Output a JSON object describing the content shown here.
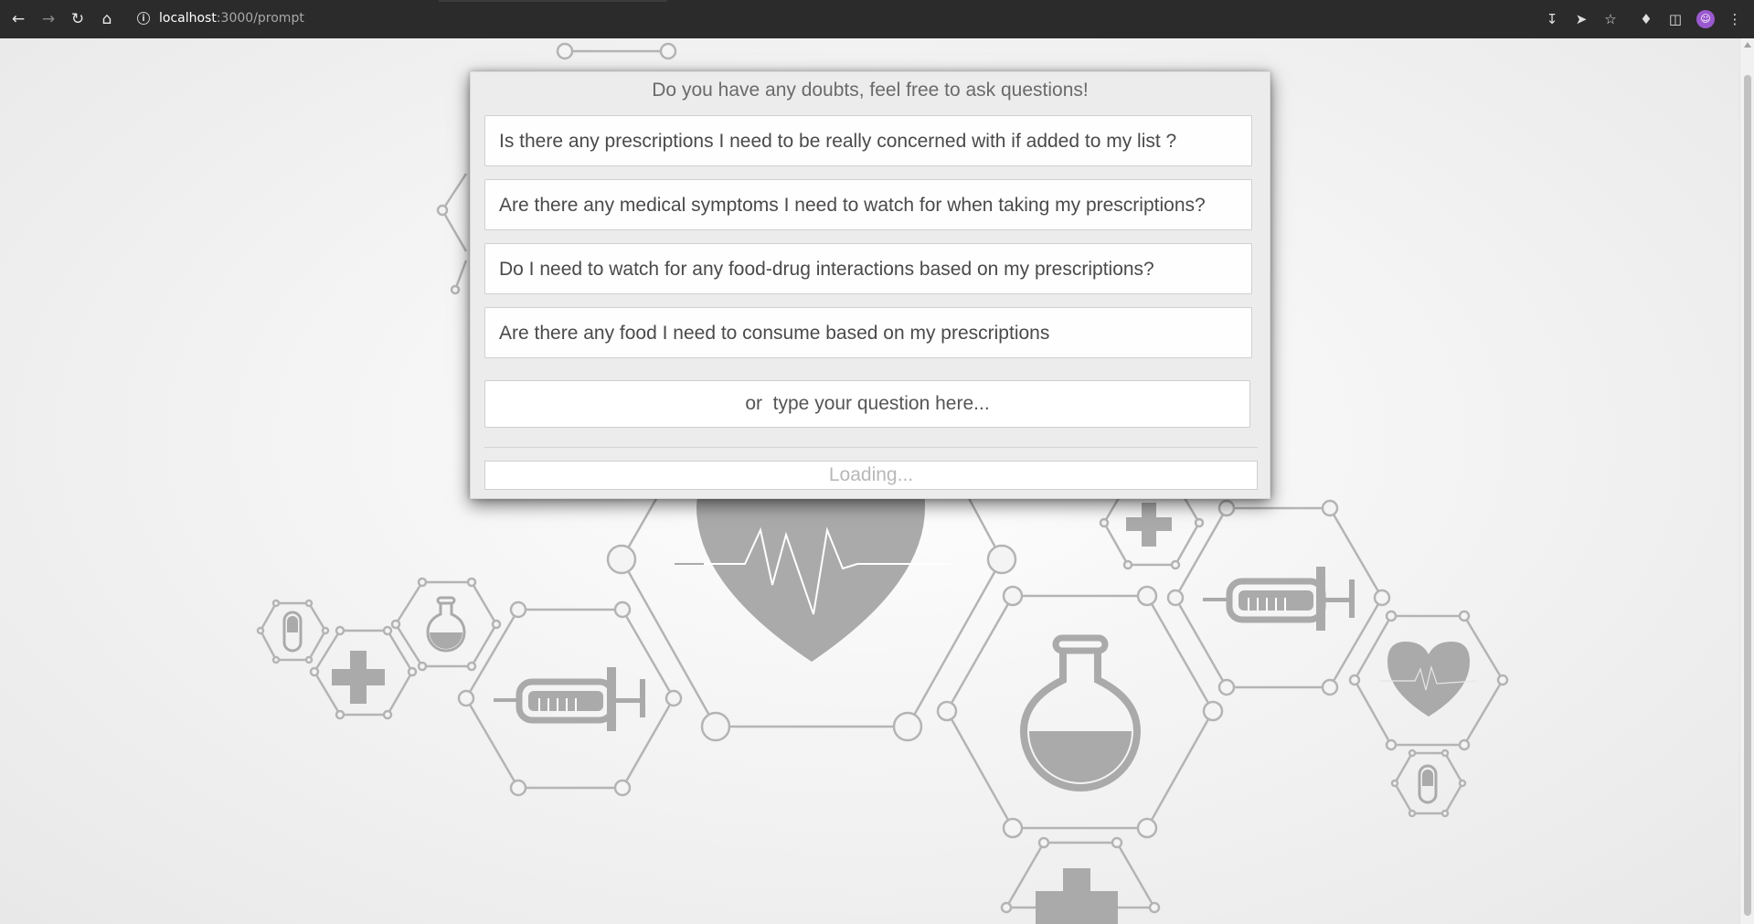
{
  "browser": {
    "url_host": "localhost",
    "url_path": ":3000/prompt",
    "avatar_icon": "person-icon"
  },
  "prompt": {
    "title": "Do you have any doubts, feel free to ask questions!",
    "questions": [
      "Is there any prescriptions I need to be really concerned with if added to my list ?",
      "Are there any medical symptoms I need to watch for when taking my prescriptions?",
      "Do I need to watch for any food-drug interactions based on my prescriptions?",
      "Are there any food I need to consume based on my prescriptions"
    ],
    "input_placeholder": "or  type your question here...",
    "status": "Loading..."
  },
  "colors": {
    "chrome_bg": "#2b2b2b",
    "modal_bg": "#ececec",
    "art_gray": "#aaaaaa"
  }
}
